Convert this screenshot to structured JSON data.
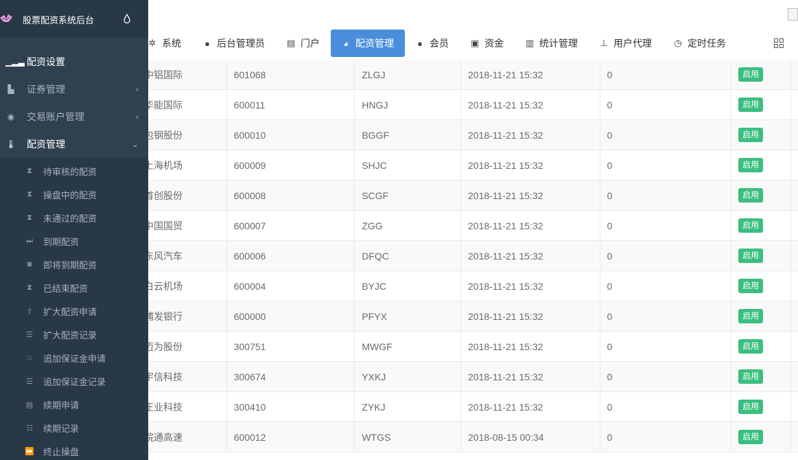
{
  "app": {
    "title": "股票配资系统后台"
  },
  "topnav": {
    "items": [
      {
        "label": "系统",
        "icon": "gear-icon"
      },
      {
        "label": "后台管理员",
        "icon": "user-icon"
      },
      {
        "label": "门户",
        "icon": "newspaper-icon"
      },
      {
        "label": "配资管理",
        "icon": "pie-chart-icon",
        "active": true
      },
      {
        "label": "会员",
        "icon": "users-icon"
      },
      {
        "label": "资金",
        "icon": "money-icon"
      },
      {
        "label": "统计管理",
        "icon": "bar-chart-icon"
      },
      {
        "label": "用户代理",
        "icon": "sitemap-icon"
      },
      {
        "label": "定时任务",
        "icon": "clock-icon"
      }
    ]
  },
  "sidebar": {
    "items": [
      {
        "label": "配资设置",
        "icon": "signal-icon"
      },
      {
        "label": "证券管理",
        "icon": "area-chart-icon",
        "arrow": "‹"
      },
      {
        "label": "交易账户管理",
        "icon": "user-circle-icon",
        "arrow": "‹"
      },
      {
        "label": "配资管理",
        "icon": "thermometer-icon",
        "arrow": "⌄"
      }
    ],
    "submenu": [
      {
        "label": "待审核的配资",
        "icon": "hourglass-icon"
      },
      {
        "label": "操盘中的配资",
        "icon": "hourglass-icon"
      },
      {
        "label": "未通过的配资",
        "icon": "hourglass-icon"
      },
      {
        "label": "到期配资",
        "icon": "step-icon"
      },
      {
        "label": "即将到期配资",
        "icon": "camera-icon"
      },
      {
        "label": "已结束配资",
        "icon": "hourglass-icon"
      },
      {
        "label": "扩大配资申请",
        "icon": "upload-icon"
      },
      {
        "label": "扩大配资记录",
        "icon": "list-icon"
      },
      {
        "label": "追加保证金申请",
        "icon": "bank-icon"
      },
      {
        "label": "追加保证金记录",
        "icon": "list-icon"
      },
      {
        "label": "续期申请",
        "icon": "file-icon"
      },
      {
        "label": "续期记录",
        "icon": "list-alt-icon"
      },
      {
        "label": "终止操盘",
        "icon": "fast-forward-icon"
      }
    ]
  },
  "table": {
    "status_color": "#3bbf7e",
    "rows": [
      {
        "name": "中铝国际",
        "code": "601068",
        "abbr": "ZLGJ",
        "time": "2018-11-21 15:32",
        "num": "0",
        "status": "启用"
      },
      {
        "name": "华能国际",
        "code": "600011",
        "abbr": "HNGJ",
        "time": "2018-11-21 15:32",
        "num": "0",
        "status": "启用"
      },
      {
        "name": "包钢股份",
        "code": "600010",
        "abbr": "BGGF",
        "time": "2018-11-21 15:32",
        "num": "0",
        "status": "启用"
      },
      {
        "name": "上海机场",
        "code": "600009",
        "abbr": "SHJC",
        "time": "2018-11-21 15:32",
        "num": "0",
        "status": "启用"
      },
      {
        "name": "首创股份",
        "code": "600008",
        "abbr": "SCGF",
        "time": "2018-11-21 15:32",
        "num": "0",
        "status": "启用"
      },
      {
        "name": "中国国贸",
        "code": "600007",
        "abbr": "ZGG",
        "time": "2018-11-21 15:32",
        "num": "0",
        "status": "启用"
      },
      {
        "name": "东风汽车",
        "code": "600006",
        "abbr": "DFQC",
        "time": "2018-11-21 15:32",
        "num": "0",
        "status": "启用"
      },
      {
        "name": "白云机场",
        "code": "600004",
        "abbr": "BYJC",
        "time": "2018-11-21 15:32",
        "num": "0",
        "status": "启用"
      },
      {
        "name": "浦发银行",
        "code": "600000",
        "abbr": "PFYX",
        "time": "2018-11-21 15:32",
        "num": "0",
        "status": "启用"
      },
      {
        "name": "迈为股份",
        "code": "300751",
        "abbr": "MWGF",
        "time": "2018-11-21 15:32",
        "num": "0",
        "status": "启用"
      },
      {
        "name": "宇信科技",
        "code": "300674",
        "abbr": "YXKJ",
        "time": "2018-11-21 15:32",
        "num": "0",
        "status": "启用"
      },
      {
        "name": "正业科技",
        "code": "300410",
        "abbr": "ZYKJ",
        "time": "2018-11-21 15:32",
        "num": "0",
        "status": "启用"
      },
      {
        "name": "皖通高速",
        "code": "600012",
        "abbr": "WTGS",
        "time": "2018-08-15 00:34",
        "num": "0",
        "status": "启用"
      }
    ]
  }
}
